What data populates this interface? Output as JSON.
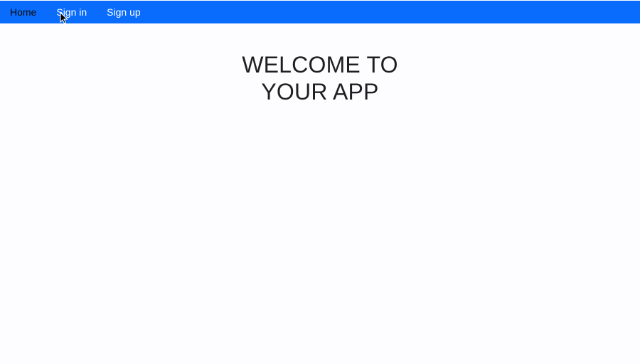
{
  "navbar": {
    "background_color": "#0a6cfc",
    "links": [
      {
        "label": "Home",
        "color": "#0b0b0b"
      },
      {
        "label": "Sign in",
        "color": "#ffffff"
      },
      {
        "label": "Sign up",
        "color": "#ffffff"
      }
    ]
  },
  "main": {
    "heading": "WELCOME TO YOUR APP"
  },
  "cursor": {
    "icon": "arrow-pointer-icon"
  }
}
